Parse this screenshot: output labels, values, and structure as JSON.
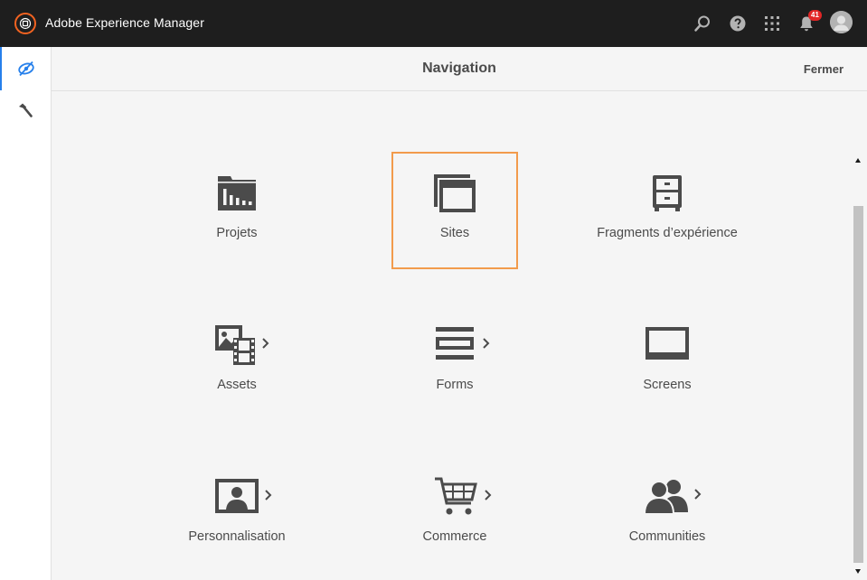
{
  "app": {
    "title": "Adobe Experience Manager"
  },
  "topbar": {
    "notifications_count": "41",
    "icons": [
      "search-icon",
      "help-icon",
      "solutions-grid-icon",
      "bell-icon",
      "user-avatar"
    ]
  },
  "header": {
    "title": "Navigation",
    "close_label": "Fermer"
  },
  "tiles": [
    {
      "label": "Projets",
      "icon": "projects-icon",
      "has_chevron": false,
      "selected": false
    },
    {
      "label": "Sites",
      "icon": "sites-icon",
      "has_chevron": false,
      "selected": true
    },
    {
      "label": "Fragments d’expérience",
      "icon": "experience-fragments-icon",
      "has_chevron": false,
      "selected": false
    },
    {
      "label": "Assets",
      "icon": "assets-icon",
      "has_chevron": true,
      "selected": false
    },
    {
      "label": "Forms",
      "icon": "forms-icon",
      "has_chevron": true,
      "selected": false
    },
    {
      "label": "Screens",
      "icon": "screens-icon",
      "has_chevron": false,
      "selected": false
    },
    {
      "label": "Personnalisation",
      "icon": "personalization-icon",
      "has_chevron": true,
      "selected": false
    },
    {
      "label": "Commerce",
      "icon": "commerce-icon",
      "has_chevron": true,
      "selected": false
    },
    {
      "label": "Communities",
      "icon": "communities-icon",
      "has_chevron": true,
      "selected": false
    }
  ],
  "colors": {
    "topbar": "#1e1e1e",
    "logo_accent": "#f26321",
    "selection_outline": "#f29b4c",
    "rail_active": "#2680eb",
    "badge": "#e22626",
    "icon": "#4b4b4b"
  }
}
